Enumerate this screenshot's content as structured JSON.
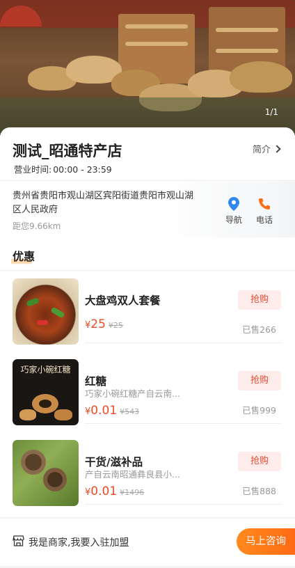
{
  "banner": {
    "counter": "1/1"
  },
  "store": {
    "name": "测试_昭通特产店",
    "intro_label": "简介",
    "hours_label": "营业时间:",
    "hours_value": "00:00 - 23:59",
    "address": "贵州省贵阳市观山湖区宾阳街道贵阳市观山湖区人民政府",
    "distance": "距您9.66km",
    "nav_label": "导航",
    "call_label": "电话"
  },
  "section": {
    "title": "优惠"
  },
  "items": [
    {
      "name": "大盘鸡双人套餐",
      "desc": "",
      "currency": "¥",
      "price": "25",
      "orig": "¥25",
      "button": "抢购",
      "sold": "已售266"
    },
    {
      "name": "红糖",
      "desc": "巧家小碗红糖产自云南...",
      "currency": "¥",
      "price": "0.01",
      "orig": "¥543",
      "button": "抢购",
      "sold": "已售999",
      "thumb_text": "巧家小碗红糖"
    },
    {
      "name": "干货/滋补品",
      "desc": "产自云南昭通彝良县小...",
      "currency": "¥",
      "price": "0.01",
      "orig": "¥1496",
      "button": "抢购",
      "sold": "已售888"
    }
  ],
  "bottom": {
    "join_text": "我是商家,我要入驻加盟",
    "consult": "马上咨询"
  },
  "colors": {
    "accent": "#ff6a14",
    "price": "#f04a24",
    "nav_blue": "#2f88f0",
    "call_orange": "#ff6a14"
  }
}
